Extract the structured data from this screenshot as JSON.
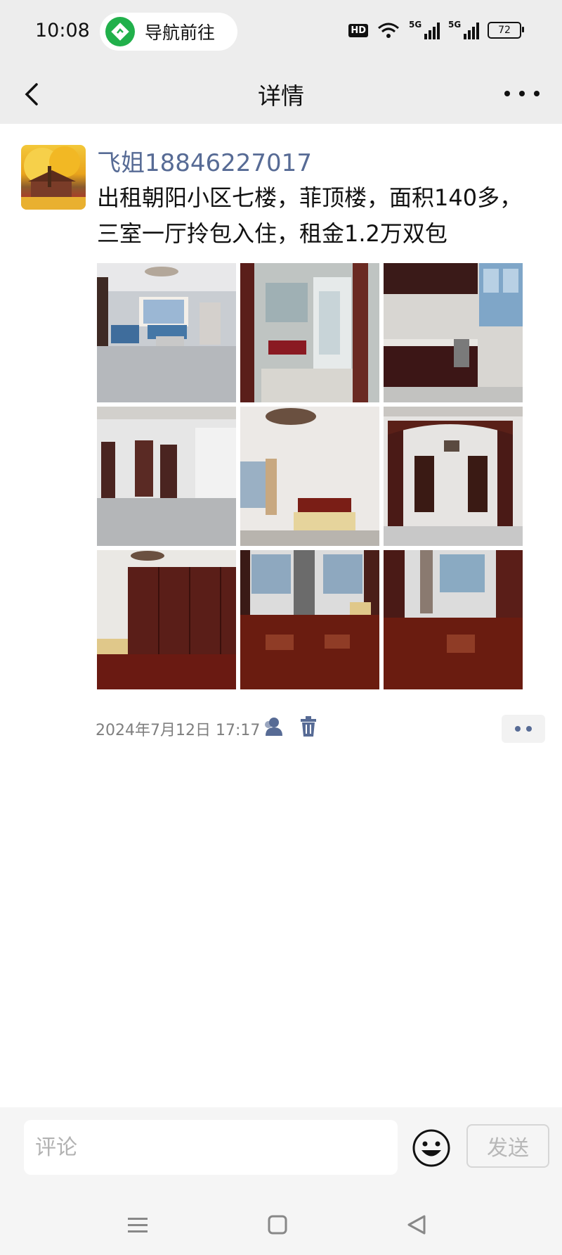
{
  "status_bar": {
    "time": "10:08",
    "nav_pill_label": "导航前往",
    "hd_label": "HD",
    "signal_label": "5G",
    "battery": "72"
  },
  "header": {
    "title": "详情",
    "back_icon": "chevron-left-icon",
    "more_icon": "more-horizontal-icon"
  },
  "post": {
    "username": "飞姐18846227017",
    "text": "出租朝阳小区七楼，菲顶楼，面积140多，三室一厅拎包入住，租金1.2万双包",
    "timestamp": "2024年7月12日 17:17",
    "photos": [
      {
        "icon": "living-room-photo"
      },
      {
        "icon": "bathroom-photo"
      },
      {
        "icon": "kitchen-photo"
      },
      {
        "icon": "hallway-photo"
      },
      {
        "icon": "bedroom-photo"
      },
      {
        "icon": "arch-cabinet-photo"
      },
      {
        "icon": "wardrobe-photo"
      },
      {
        "icon": "wood-floor-room-photo"
      },
      {
        "icon": "empty-room-photo"
      }
    ]
  },
  "comment_bar": {
    "placeholder": "评论",
    "send_label": "发送"
  },
  "colors": {
    "link": "#576b95",
    "bar_bg": "#ededed",
    "nav_green": "#21b04b"
  }
}
